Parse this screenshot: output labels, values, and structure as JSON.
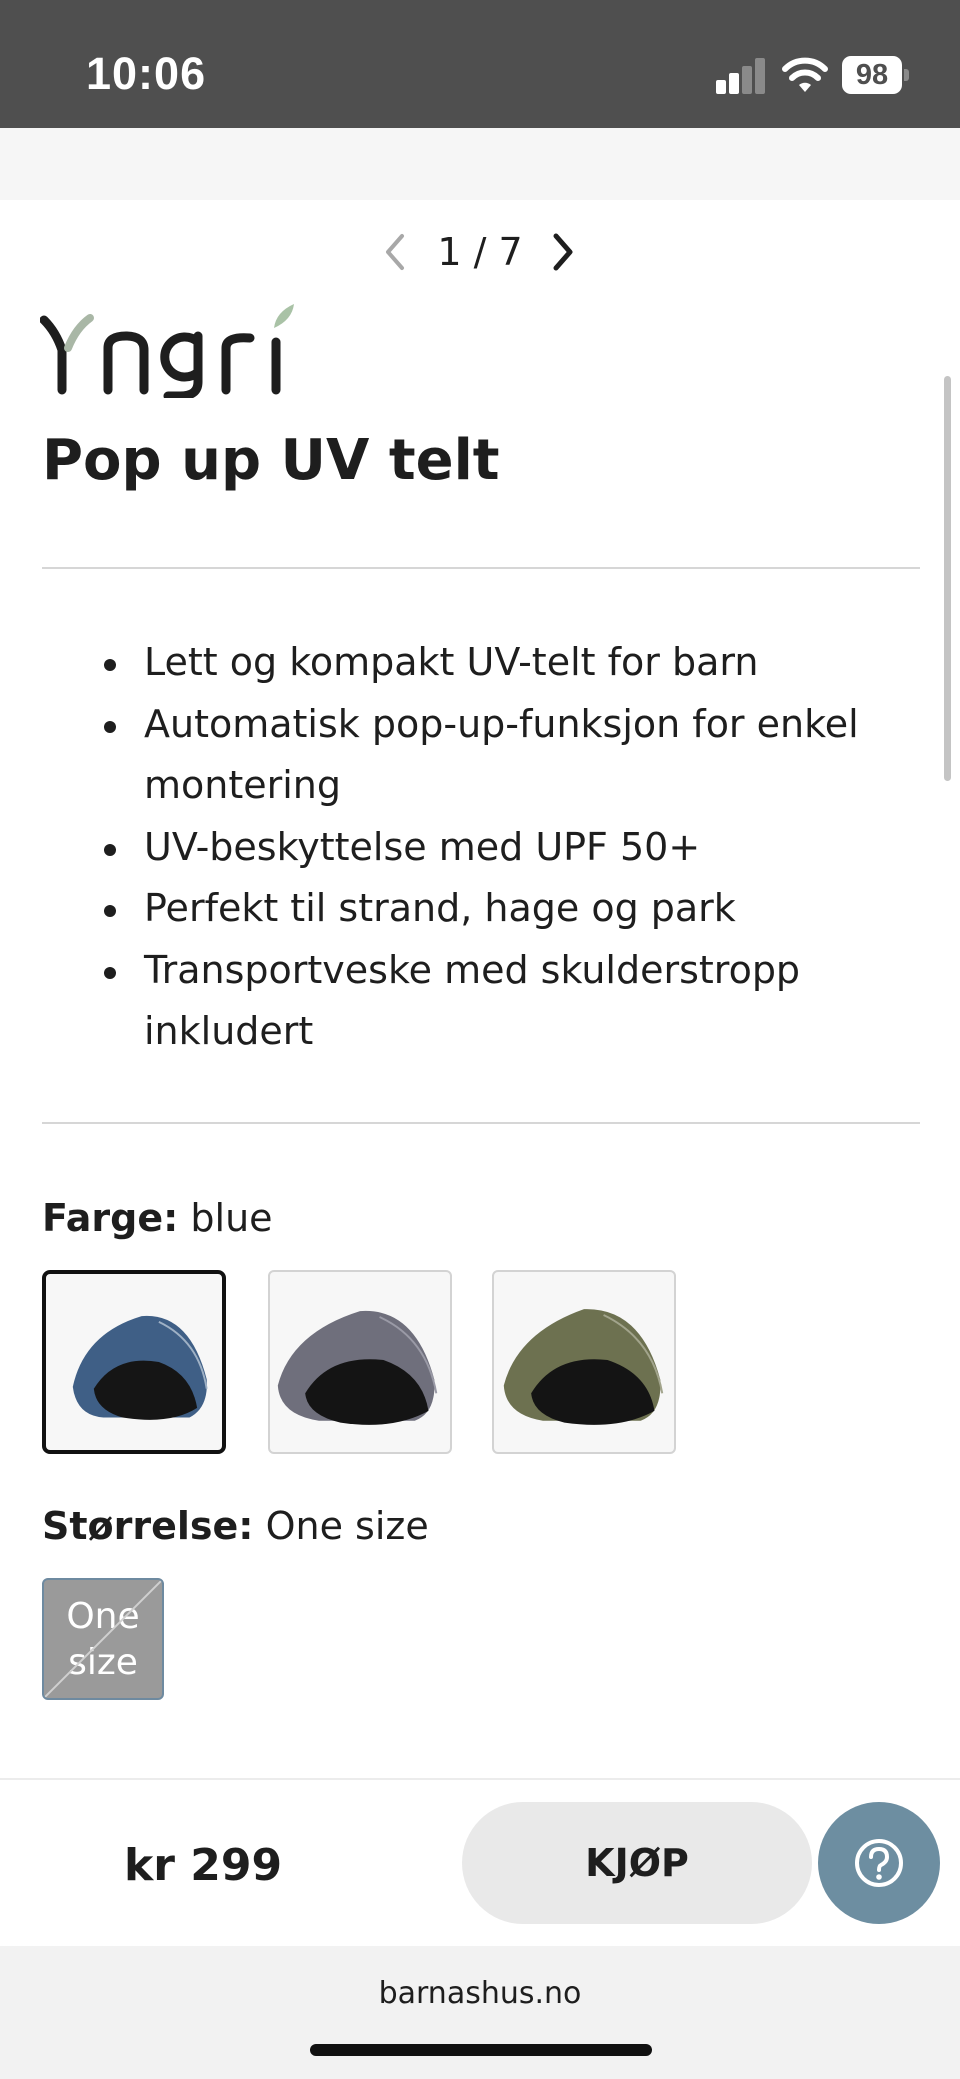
{
  "status_bar": {
    "time": "10:06",
    "battery": "98",
    "icons": [
      "signal-icon",
      "wifi-icon",
      "battery-icon"
    ]
  },
  "gallery": {
    "counter": "1 / 7",
    "prev_icon": "chevron-left-icon",
    "next_icon": "chevron-right-icon"
  },
  "product": {
    "brand": "Yngri",
    "title": "Pop up UV telt",
    "features": [
      "Lett og kompakt UV-telt for barn",
      "Automatisk pop-up-funksjon for enkel montering",
      "UV-beskyttelse med UPF 50+",
      "Perfekt til strand, hage og park",
      "Transportveske med skulderstropp inkludert"
    ]
  },
  "color_option": {
    "label": "Farge:",
    "value": "blue",
    "swatches": [
      {
        "name": "blue",
        "color": "#3f5f86",
        "selected": true
      },
      {
        "name": "grey",
        "color": "#6f6f7c",
        "selected": false
      },
      {
        "name": "green",
        "color": "#6d7150",
        "selected": false
      }
    ]
  },
  "size_option": {
    "label": "Størrelse:",
    "value": "One size",
    "chip_label_line1": "One",
    "chip_label_line2": "size"
  },
  "purchase": {
    "price": "kr 299",
    "buy_label": "KJØP",
    "help_icon": "question-circle-icon"
  },
  "browser": {
    "url": "barnashus.no"
  },
  "colors": {
    "status_bar_bg": "#4f4f4f",
    "help_button_bg": "#6d8ea1",
    "buy_button_bg": "#e9e9e9"
  }
}
